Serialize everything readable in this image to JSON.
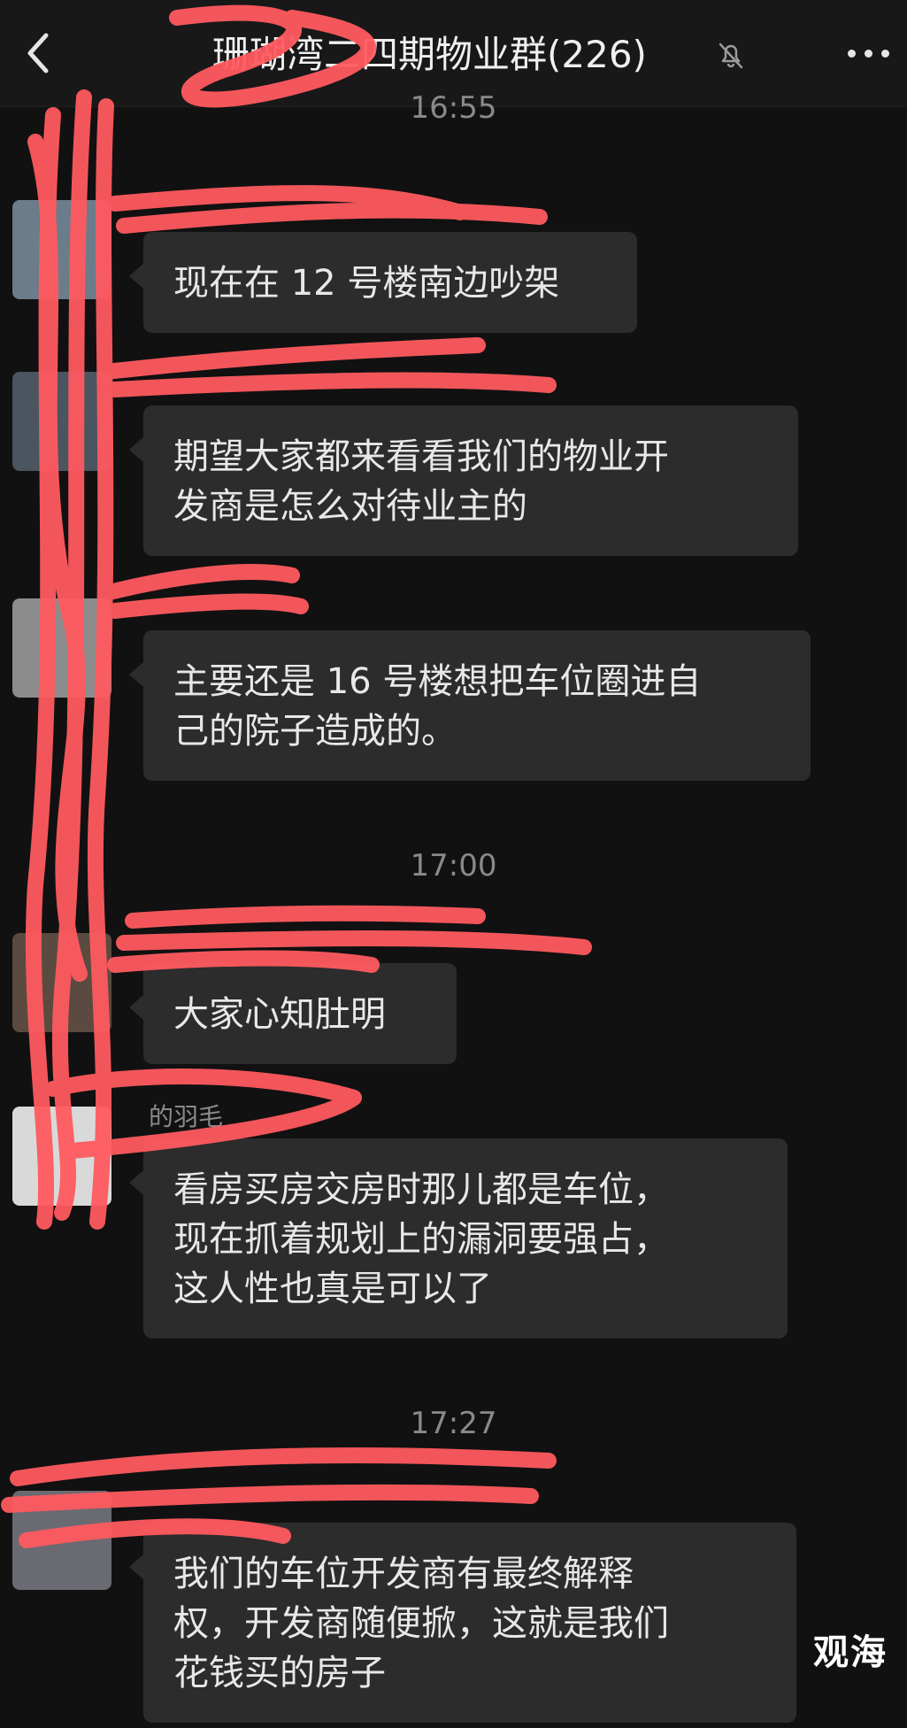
{
  "header": {
    "title": "珊瑚湾二四期物业群(226)",
    "back_icon": "chevron-left-icon",
    "mute_icon": "bell-muted-icon",
    "more_icon": "more-dots-icon"
  },
  "timestamps": [
    "16:55",
    "17:00",
    "17:27"
  ],
  "messages": [
    {
      "sender": "",
      "text": "现在在 12 号楼南边吵架"
    },
    {
      "sender": "",
      "text": "期望大家都来看看我们的物业开\n发商是怎么对待业主的"
    },
    {
      "sender": "",
      "text": "主要还是 16 号楼想把车位圈进自\n己的院子造成的。"
    },
    {
      "sender": "",
      "text": "大家心知肚明"
    },
    {
      "sender": "的羽毛",
      "text": "看房买房交房时那儿都是车位，\n现在抓着规划上的漏洞要强占，\n这人性也真是可以了"
    },
    {
      "sender": "",
      "text": "我们的车位开发商有最终解释\n权，开发商随便掀，这就是我们\n花钱买的房子"
    }
  ],
  "watermark": "观海",
  "colors": {
    "background": "#111111",
    "bubble": "#2c2c2c",
    "scribble": "#ff5a5f"
  }
}
